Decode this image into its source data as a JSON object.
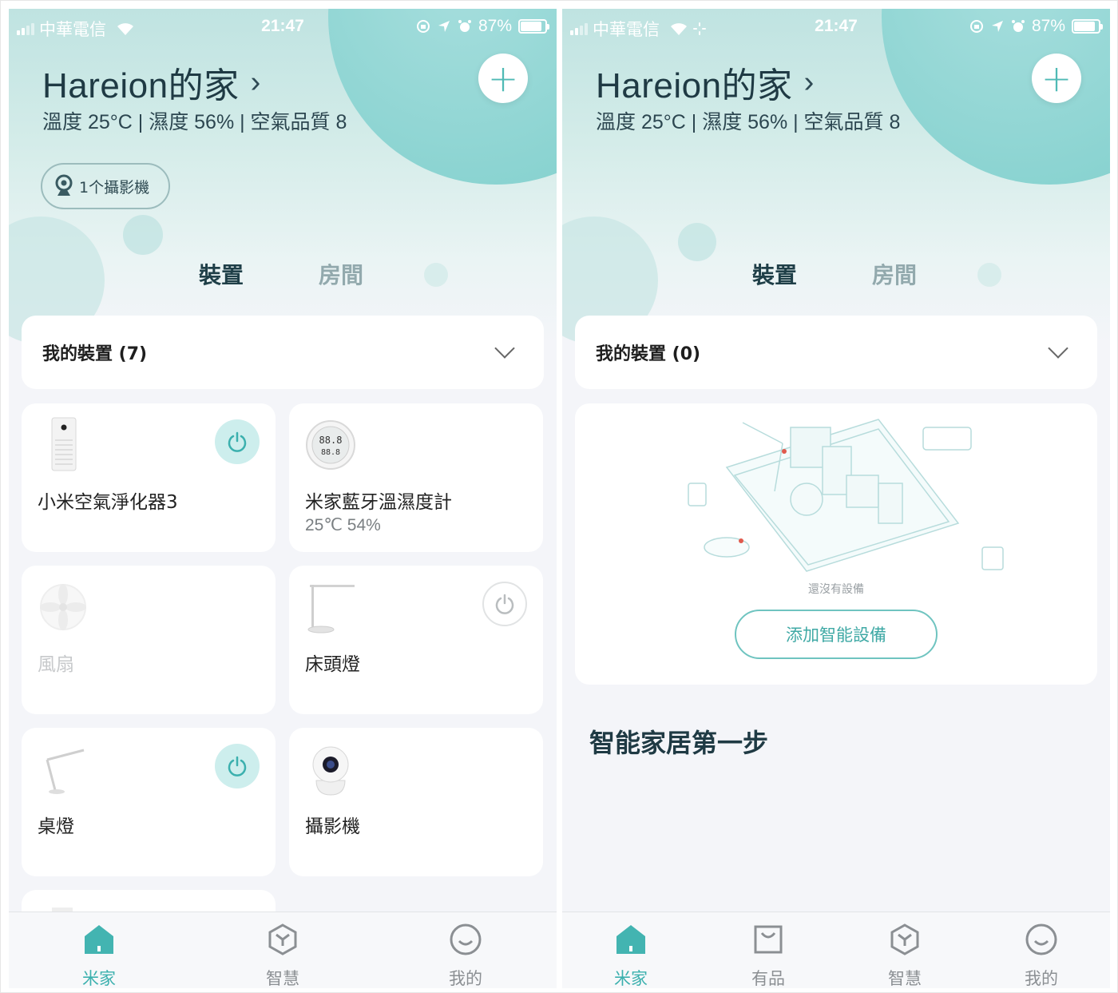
{
  "status": {
    "carrier": "中華電信",
    "time": "21:47",
    "battery": "87%",
    "battery_level": 0.87
  },
  "home": {
    "title": "Hareion的家",
    "env": "溫度 25°C | 濕度 56% | 空氣品質 8",
    "camera_pill": "1个攝影機"
  },
  "tabs": {
    "devices": "裝置",
    "rooms": "房間"
  },
  "left": {
    "my_devices": "我的裝置 (7)",
    "devices": [
      {
        "name": "小米空氣淨化器3",
        "sub": "",
        "icon": "air-purifier-icon",
        "power": "on"
      },
      {
        "name": "米家藍牙溫濕度計",
        "sub": "25℃ 54%",
        "icon": "thermometer-hygrometer-icon",
        "power": "none"
      },
      {
        "name": "風扇",
        "sub": "",
        "icon": "fan-icon",
        "power": "offline"
      },
      {
        "name": "床頭燈",
        "sub": "",
        "icon": "bedside-lamp-icon",
        "power": "off"
      },
      {
        "name": "桌燈",
        "sub": "",
        "icon": "desk-lamp-icon",
        "power": "on"
      },
      {
        "name": "攝影機",
        "sub": "",
        "icon": "camera-icon",
        "power": "none"
      }
    ],
    "tabbar": [
      "米家",
      "智慧",
      "我的"
    ]
  },
  "right": {
    "my_devices": "我的裝置 (0)",
    "empty_text": "還沒有設備",
    "add_button": "添加智能設備",
    "section_title": "智能家居第一步",
    "tabbar": [
      "米家",
      "有品",
      "智慧",
      "我的"
    ]
  },
  "colors": {
    "accent": "#3bb0ae",
    "hero": "#bfe3e1",
    "text_dark": "#1f3a44"
  }
}
